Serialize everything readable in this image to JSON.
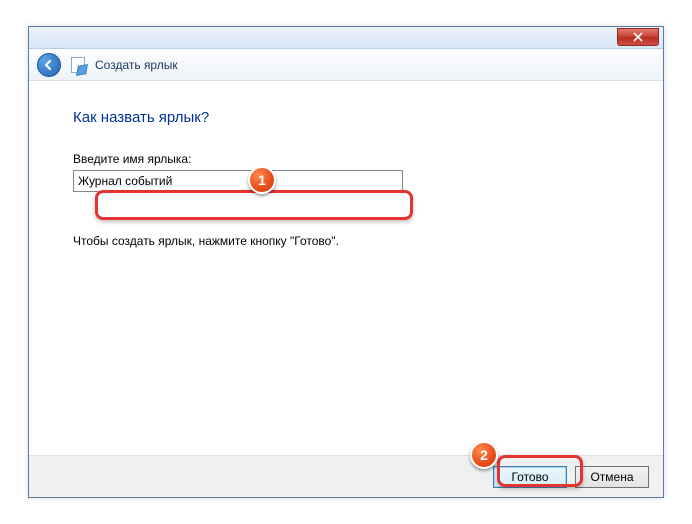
{
  "header": {
    "title": "Создать ярлык"
  },
  "content": {
    "heading": "Как назвать ярлык?",
    "field_label": "Введите имя ярлыка:",
    "input_value": "Журнал событий",
    "instruction": "Чтобы создать ярлык, нажмите кнопку \"Готово\"."
  },
  "footer": {
    "finish_label": "Готово",
    "cancel_label": "Отмена"
  },
  "annotations": {
    "badge1": "1",
    "badge2": "2"
  }
}
